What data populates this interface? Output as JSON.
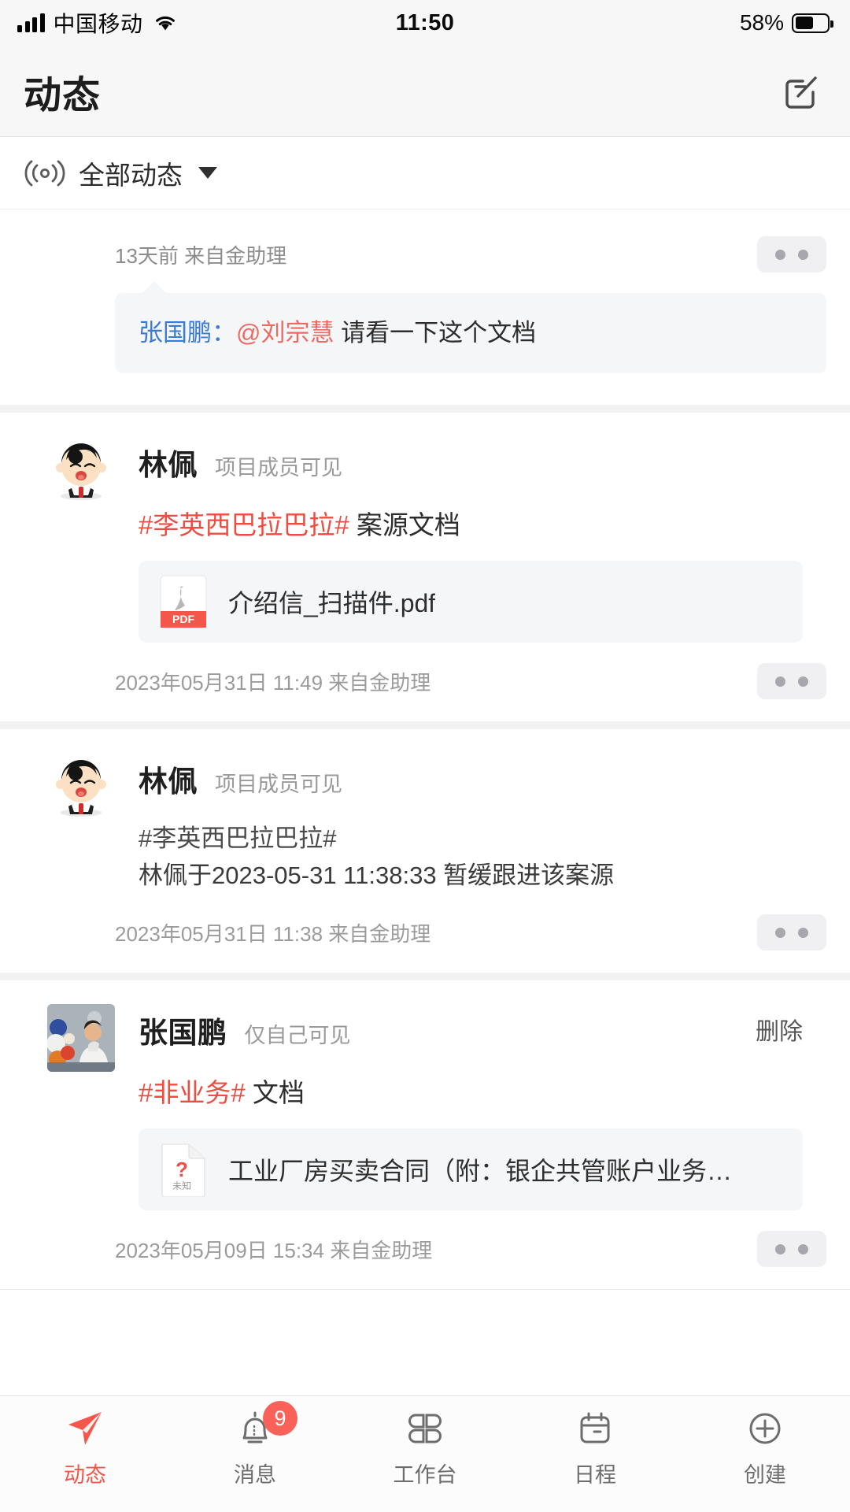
{
  "status_bar": {
    "carrier": "中国移动",
    "time": "11:50",
    "battery_percent": "58%",
    "signal_icon": "signal-bars-icon",
    "wifi_icon": "wifi-icon",
    "battery_icon": "battery-icon",
    "battery_level": 58
  },
  "nav": {
    "title": "动态",
    "compose_icon": "compose-icon"
  },
  "filter": {
    "icon": "broadcast-icon",
    "label": "全部动态",
    "caret_icon": "chevron-down-icon"
  },
  "colors": {
    "accent_red": "#f4564a",
    "hashtag_red": "#ee4c40",
    "mention_red": "#ee6a61",
    "link_blue": "#3a7bd5",
    "badge_red": "#fa6159",
    "bubble_bg": "#f5f6f8",
    "divider": "#f2f2f2"
  },
  "feed": [
    {
      "type": "mention",
      "meta": "13天前 来自金助理",
      "more_icon": "more-dots-icon",
      "bubble": {
        "sender": "张国鹏：",
        "mention": "@刘宗慧",
        "text": "请看一下这个文档"
      }
    },
    {
      "type": "post",
      "avatar": "cartoon-avatar",
      "author": "林佩",
      "visibility": "项目成员可见",
      "hashtag": "#李英西巴拉巴拉#",
      "hashtag_style": "red",
      "title_rest": "案源文档",
      "attachment": {
        "icon": "pdf-file-icon",
        "icon_label": "PDF",
        "name": "介绍信_扫描件.pdf"
      },
      "timestamp": "2023年05月31日 11:49 来自金助理",
      "more_icon": "more-dots-icon"
    },
    {
      "type": "post",
      "avatar": "cartoon-avatar",
      "author": "林佩",
      "visibility": "项目成员可见",
      "hashtag": "#李英西巴拉巴拉#",
      "hashtag_style": "gray",
      "body_line": "林佩于2023-05-31 11:38:33 暂缓跟进该案源",
      "timestamp": "2023年05月31日 11:38 来自金助理",
      "more_icon": "more-dots-icon"
    },
    {
      "type": "post",
      "avatar": "photo-avatar",
      "author": "张国鹏",
      "visibility": "仅自己可见",
      "action_label": "删除",
      "hashtag": "#非业务#",
      "hashtag_style": "red",
      "title_rest": "文档",
      "attachment": {
        "icon": "unknown-file-icon",
        "icon_label": "未知",
        "name": "工业厂房买卖合同（附：银企共管账户业务…"
      },
      "timestamp": "2023年05月09日 15:34 来自金助理",
      "more_icon": "more-dots-icon"
    }
  ],
  "tabbar": [
    {
      "label": "动态",
      "icon": "paper-plane-icon",
      "active": true,
      "badge": ""
    },
    {
      "label": "消息",
      "icon": "bell-icon",
      "active": false,
      "badge": "9"
    },
    {
      "label": "工作台",
      "icon": "grid-apps-icon",
      "active": false,
      "badge": ""
    },
    {
      "label": "日程",
      "icon": "calendar-icon",
      "active": false,
      "badge": ""
    },
    {
      "label": "创建",
      "icon": "plus-circle-icon",
      "active": false,
      "badge": ""
    }
  ]
}
